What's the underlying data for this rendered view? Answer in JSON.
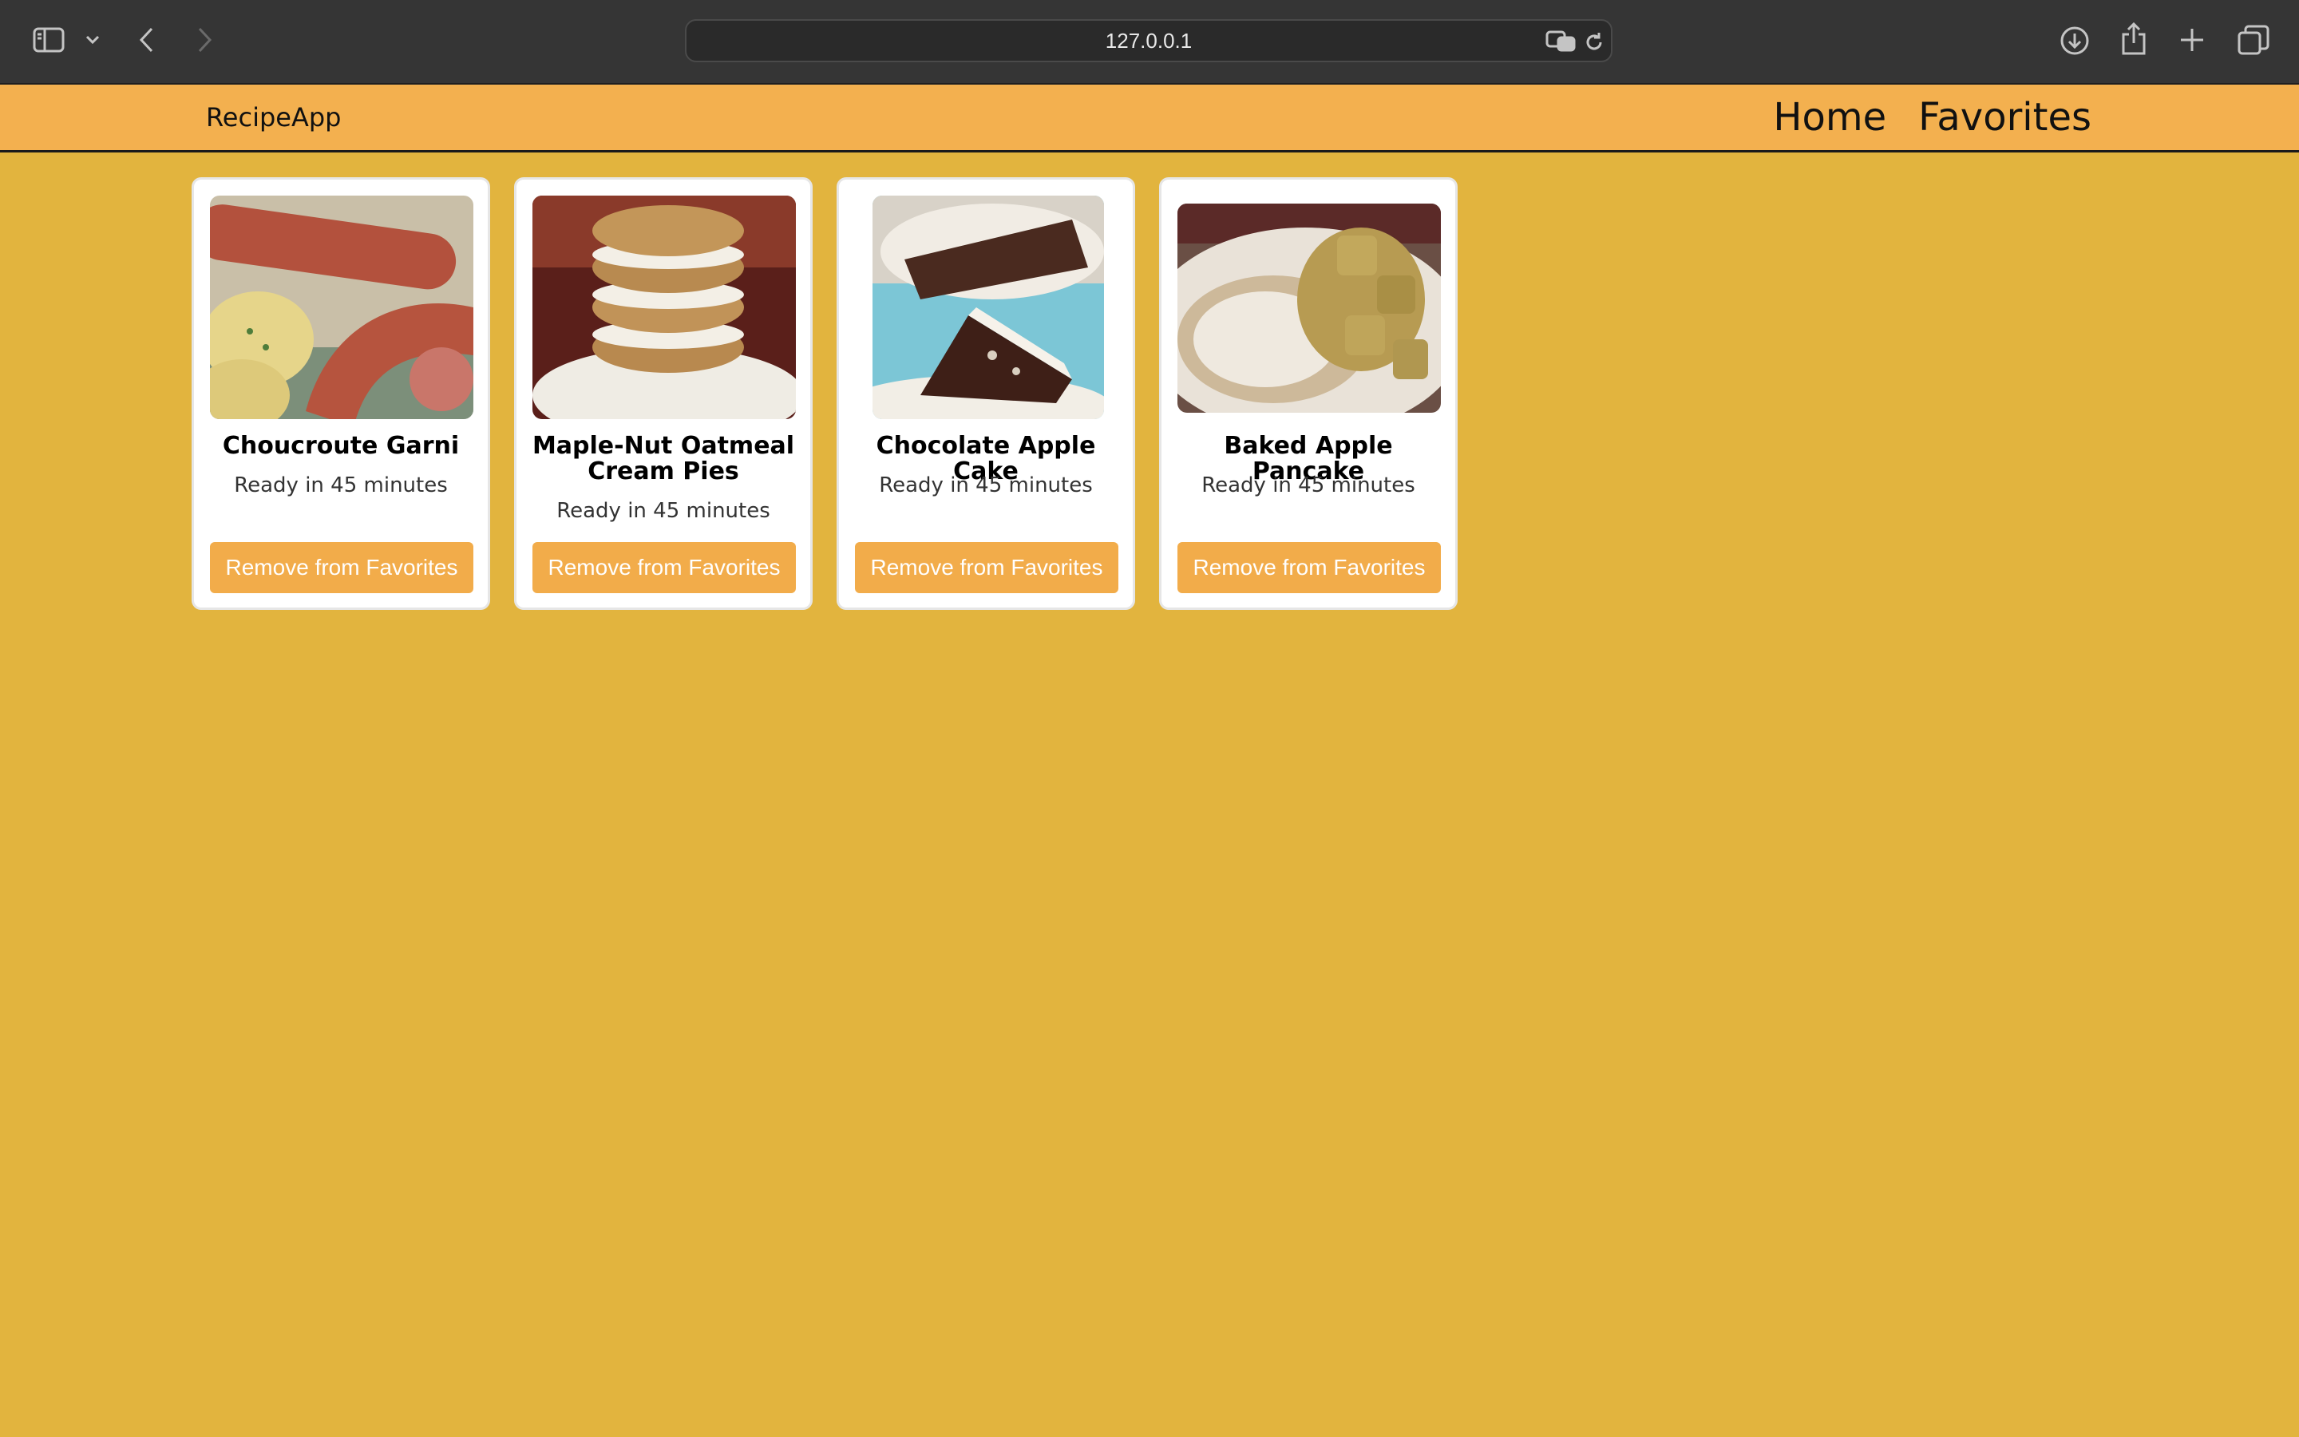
{
  "browser": {
    "url": "127.0.0.1",
    "icons": [
      "sidebar-icon",
      "chevron-down-icon",
      "back-icon",
      "forward-icon",
      "translate-icon",
      "reload-icon",
      "download-icon",
      "share-icon",
      "new-tab-icon",
      "tabs-overview-icon"
    ]
  },
  "nav": {
    "brand": "RecipeApp",
    "links": [
      "Home",
      "Favorites"
    ]
  },
  "recipes": [
    {
      "title": "Choucroute Garni",
      "ready": "Ready in 45 minutes",
      "button": "Remove from Favorites"
    },
    {
      "title": "Maple-Nut Oatmeal Cream Pies",
      "ready": "Ready in 45 minutes",
      "button": "Remove from Favorites"
    },
    {
      "title": "Chocolate Apple Cake",
      "ready": "Ready in 45 minutes",
      "button": "Remove from Favorites"
    },
    {
      "title": "Baked Apple Pancake",
      "ready": "Ready in 45 minutes",
      "button": "Remove from Favorites"
    }
  ],
  "colors": {
    "page_background": "#e2b43e",
    "navbar": "#f3b04f",
    "button": "#f2ac4a"
  }
}
